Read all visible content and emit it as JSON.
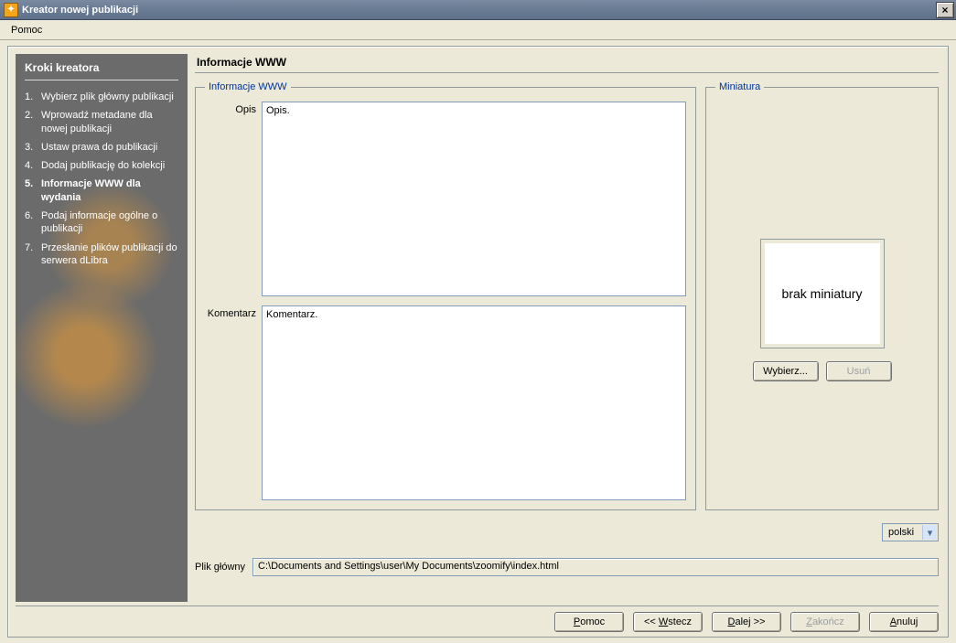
{
  "window": {
    "title": "Kreator nowej publikacji",
    "close": "×"
  },
  "menu": {
    "help": "Pomoc"
  },
  "sidebar": {
    "header": "Kroki kreatora",
    "steps": [
      "Wybierz plik główny publikacji",
      "Wprowadź metadane dla nowej publikacji",
      "Ustaw prawa do publikacji",
      "Dodaj publikację do kolekcji",
      "Informacje WWW dla wydania",
      "Podaj informacje ogólne o publikacji",
      "Przesłanie plików publikacji do serwera dLibra"
    ],
    "active_index": 4
  },
  "main": {
    "title": "Informacje WWW",
    "www": {
      "legend": "Informacje WWW",
      "opis_label": "Opis",
      "opis_value": "Opis.",
      "kom_label": "Komentarz",
      "kom_value": "Komentarz."
    },
    "mini": {
      "legend": "Miniatura",
      "placeholder": "brak miniatury",
      "choose": "Wybierz...",
      "delete": "Usuń"
    },
    "language": {
      "value": "polski"
    },
    "mainfile": {
      "label": "Plik główny",
      "value": "C:\\Documents and Settings\\user\\My Documents\\zoomify\\index.html"
    }
  },
  "footer": {
    "help": "Pomoc",
    "back": "<< Wstecz",
    "next": "Dalej >>",
    "finish": "Zakończ",
    "cancel": "Anuluj"
  }
}
